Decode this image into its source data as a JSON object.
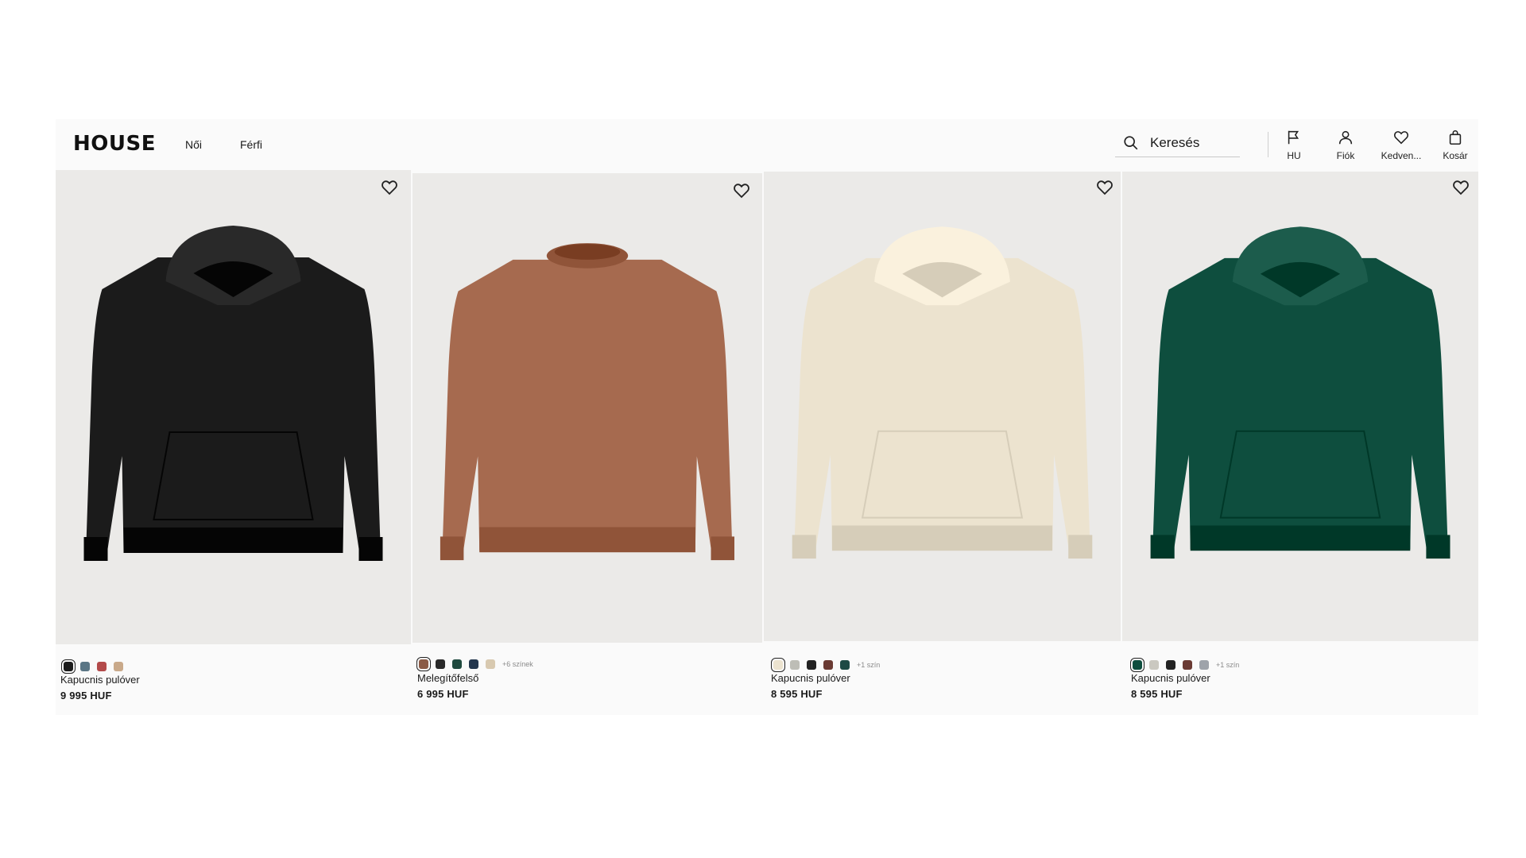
{
  "header": {
    "logo": "HOUSE",
    "nav": [
      {
        "label": "Női"
      },
      {
        "label": "Férfi"
      }
    ],
    "search": {
      "placeholder": "Keresés"
    },
    "actions": [
      {
        "label": "HU",
        "icon": "flag-icon"
      },
      {
        "label": "Fiók",
        "icon": "user-icon"
      },
      {
        "label": "Kedven...",
        "icon": "heart-icon"
      },
      {
        "label": "Kosár",
        "icon": "bag-icon"
      }
    ]
  },
  "products": [
    {
      "name": "Kapucnis pulóver",
      "price": "9 995 HUF",
      "style": "hoodie",
      "color": "#1b1b1b",
      "swatches": [
        "#1b1b1b",
        "#5b7685",
        "#b34a4a",
        "#c9a98a"
      ],
      "more": ""
    },
    {
      "name": "Melegítőfelső",
      "price": "6 995 HUF",
      "style": "crewneck",
      "color": "#a66a4f",
      "swatches": [
        "#8a5a45",
        "#2a2a2a",
        "#1f4a3f",
        "#23364d",
        "#d8c9b0"
      ],
      "more": "+6 színek"
    },
    {
      "name": "Kapucnis pulóver",
      "price": "8 595 HUF",
      "style": "hoodie",
      "color": "#ece3cf",
      "swatches": [
        "#ece3cf",
        "#bdbdb6",
        "#222222",
        "#6a3a33",
        "#1e4a45"
      ],
      "more": "+1 szín"
    },
    {
      "name": "Kapucnis pulóver",
      "price": "8 595 HUF",
      "style": "hoodie",
      "color": "#0e4e3e",
      "swatches": [
        "#0e4e3e",
        "#cac8c0",
        "#222222",
        "#6a3a33",
        "#9ea3aa"
      ],
      "more": "+1 szín"
    }
  ],
  "colors": {
    "accent": "#1a1a1a",
    "photo_bg": "#ebeae8",
    "page_bg": "#fafafa"
  }
}
